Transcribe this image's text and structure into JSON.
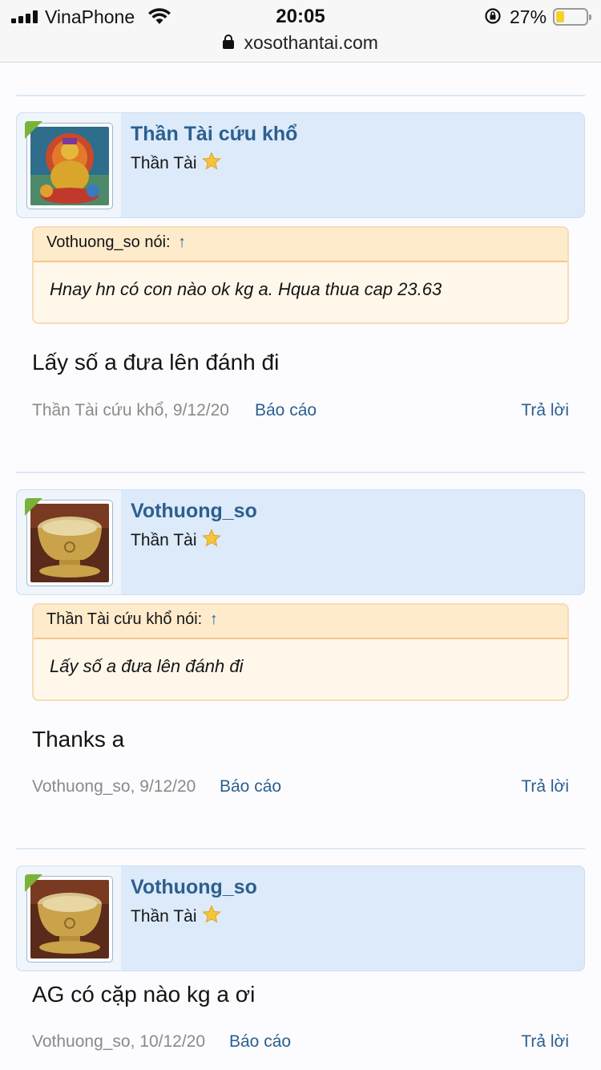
{
  "status_bar": {
    "carrier": "VinaPhone",
    "time": "20:05",
    "battery_pct": "27%",
    "battery_level": 0.27,
    "battery_color": "#f6d02a"
  },
  "browser": {
    "url": "xosothantai.com"
  },
  "colors": {
    "username": "#2c5f8f",
    "link": "#2c5f8f",
    "user_box_bg": "#dceafa",
    "quote_header_bg": "#fdebcc",
    "online_badge": "#7ab33a"
  },
  "posts": [
    {
      "username": "Thần Tài cứu khổ",
      "user_title": "Thần Tài",
      "avatar_icon": "deity-thangka-avatar",
      "quote": {
        "author_label": "Vothuong_so nói:",
        "arrow": "↑",
        "text": "Hnay hn có con nào ok kg a. Hqua thua cap 23.63"
      },
      "message": "Lấy số a đưa lên đánh đi",
      "meta": "Thần Tài cứu khổ, 9/12/20",
      "report_label": "Báo cáo",
      "reply_label": "Trả lời"
    },
    {
      "username": "Vothuong_so",
      "user_title": "Thần Tài",
      "avatar_icon": "golden-bowl-avatar",
      "quote": {
        "author_label": "Thần Tài cứu khổ nói:",
        "arrow": "↑",
        "text": "Lấy số a đưa lên đánh đi"
      },
      "message": "Thanks a",
      "meta": "Vothuong_so, 9/12/20",
      "report_label": "Báo cáo",
      "reply_label": "Trả lời"
    },
    {
      "username": "Vothuong_so",
      "user_title": "Thần Tài",
      "avatar_icon": "golden-bowl-avatar",
      "message": "AG có cặp nào kg a ơi",
      "meta": "Vothuong_so, 10/12/20",
      "report_label": "Báo cáo",
      "reply_label": "Trả lời"
    }
  ]
}
